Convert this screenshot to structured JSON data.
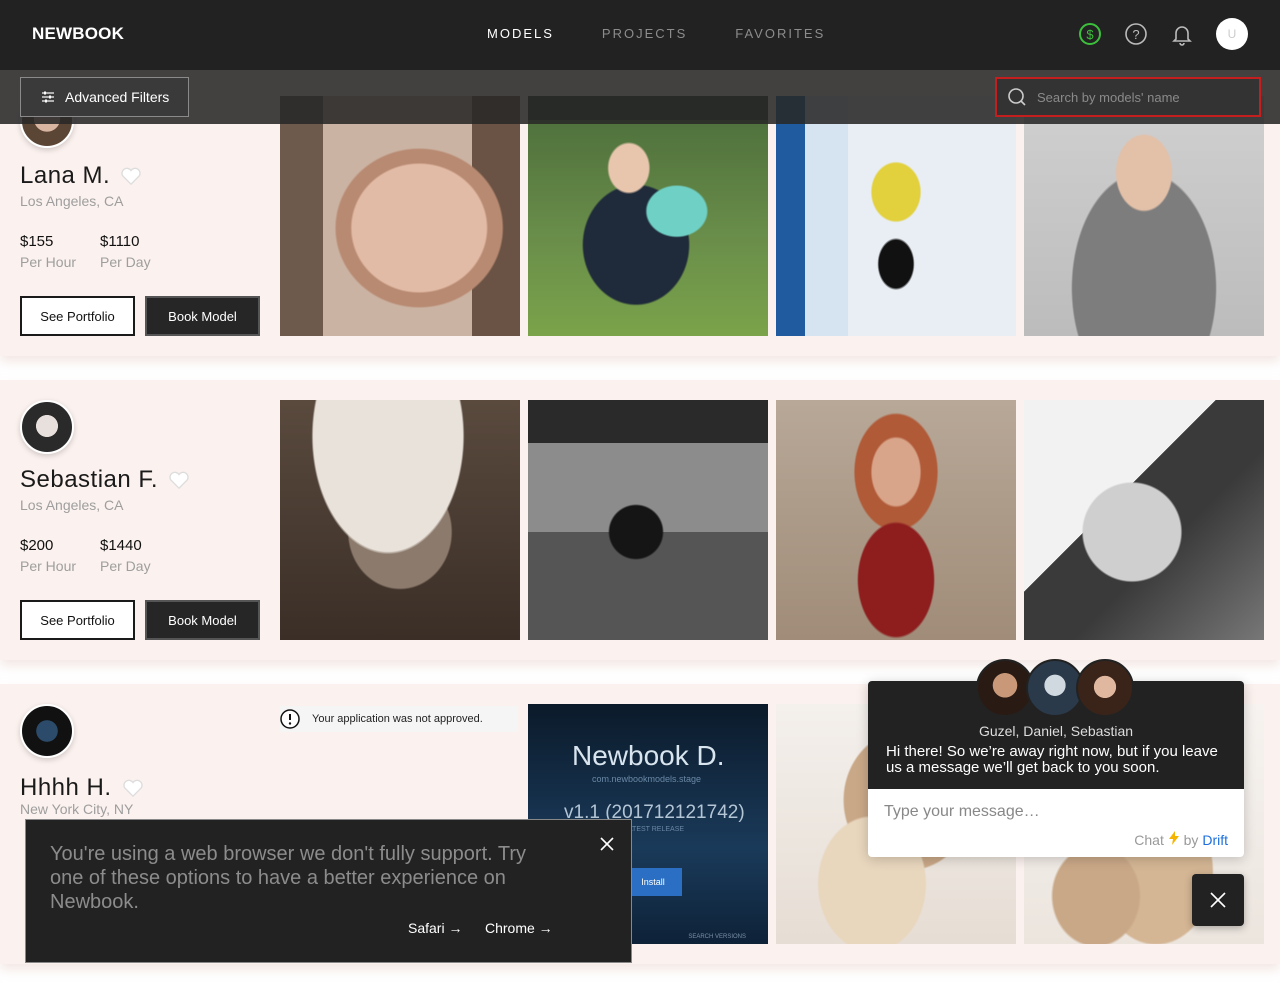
{
  "header": {
    "logo": "NEWBOOK",
    "nav": [
      {
        "label": "MODELS",
        "active": true
      },
      {
        "label": "PROJECTS",
        "active": false
      },
      {
        "label": "FAVORITES",
        "active": false
      }
    ],
    "avatar_initial": "U"
  },
  "filters": {
    "advanced_label": "Advanced Filters",
    "search_placeholder": "Search by models' name"
  },
  "models": [
    {
      "name": "Lana M.",
      "location": "Los Angeles, CA",
      "hour_price": "$155",
      "hour_label": "Per Hour",
      "day_price": "$1110",
      "day_label": "Per Day",
      "see_portfolio": "See Portfolio",
      "book": "Book Model"
    },
    {
      "name": "Sebastian F.",
      "location": "Los Angeles, CA",
      "hour_price": "$200",
      "hour_label": "Per Hour",
      "day_price": "$1440",
      "day_label": "Per Day",
      "see_portfolio": "See Portfolio",
      "book": "Book Model"
    },
    {
      "name": "Hhhh H.",
      "location": "New York City, NY",
      "notice": "Your application was not approved."
    }
  ],
  "app_preview": {
    "title": "Newbook D.",
    "subtitle": "com.newbookmodels.stage",
    "version": "v1.1 (201712121742)",
    "release": "LATEST RELEASE",
    "install": "Install",
    "footer": "SEARCH VERSIONS"
  },
  "browser_warning": {
    "message": "You're using a web browser we don't fully support. Try one of these options to have a better experience on Newbook.",
    "safari": "Safari →",
    "chrome": "Chrome →"
  },
  "chat": {
    "team": "Guzel, Daniel, Sebastian",
    "greeting": "Hi there! So we’re away right now, but if you leave us a message we’ll get back to you soon.",
    "placeholder": "Type your message…",
    "powered_prefix": "Chat",
    "powered_by": "by",
    "powered_brand": "Drift"
  },
  "colors": {
    "dark": "#222222",
    "card_bg": "#fbf1ee",
    "search_border": "#c41e1e",
    "dollar_green": "#3cc03c",
    "drift_blue": "#1d6fe0"
  }
}
